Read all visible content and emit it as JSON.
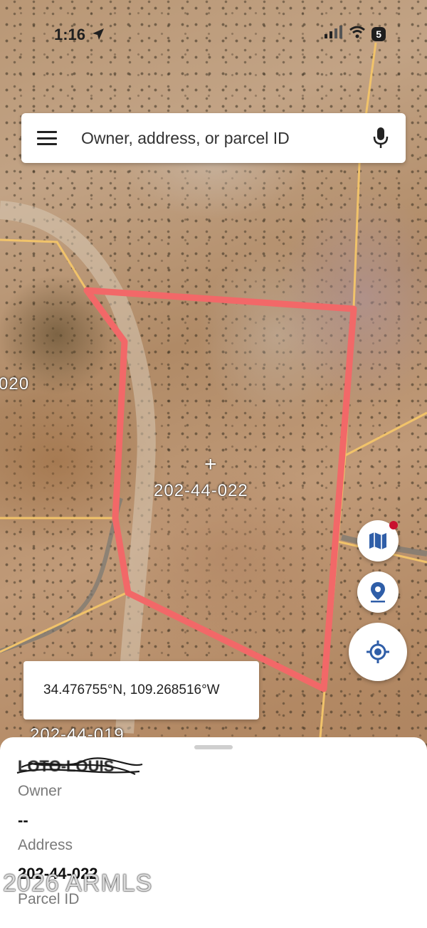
{
  "status_bar": {
    "time": "1:16",
    "battery": "5",
    "icons": [
      "location-arrow-icon",
      "signal-icon",
      "wifi-icon",
      "battery-icon"
    ]
  },
  "search": {
    "placeholder": "Owner, address, or parcel ID",
    "menu_icon": "hamburger-menu-icon",
    "mic_icon": "microphone-icon"
  },
  "map": {
    "parcel_labels": {
      "selected": "202-44-022",
      "left": "020",
      "bottom": "202-44-019"
    },
    "highlight_color": "#f26868",
    "boundary_color": "#f1c36a"
  },
  "controls": {
    "layers_icon": "map-layers-icon",
    "pin_icon": "location-pin-icon",
    "locate_icon": "my-location-icon",
    "accent_color": "#2f5ea8",
    "notification_dot_color": "#c8102e"
  },
  "coordinates": "34.476755°N, 109.268516°W",
  "sheet": {
    "owner_value": "LOTO-LOUIS",
    "owner_label": "Owner",
    "address_value": "--",
    "address_label": "Address",
    "parcel_value": "202-44-022",
    "parcel_label": "Parcel ID"
  },
  "watermark": "2026 ARMLS"
}
